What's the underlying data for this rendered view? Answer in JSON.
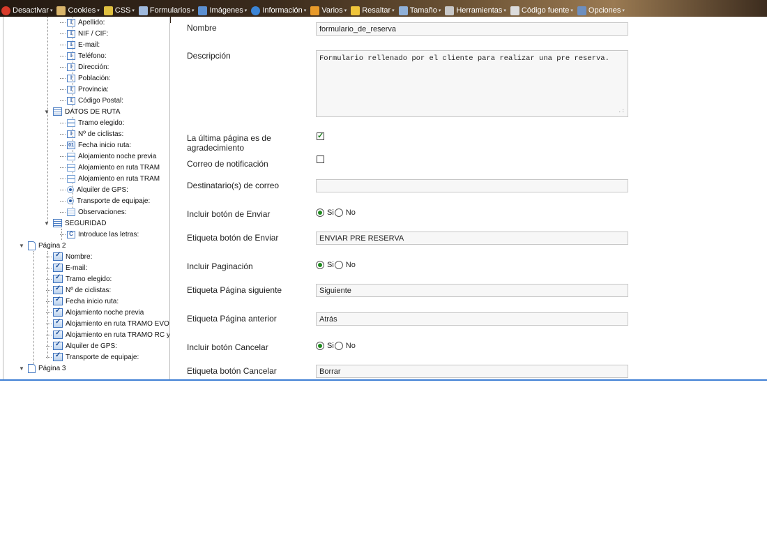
{
  "toolbar": {
    "items": [
      {
        "label": "Desactivar",
        "icon": "no-entry-icon",
        "color": "#d83a2a"
      },
      {
        "label": "Cookies",
        "icon": "person-icon",
        "color": "#d9b56b"
      },
      {
        "label": "CSS",
        "icon": "brush-icon",
        "color": "#e0c040"
      },
      {
        "label": "Formularios",
        "icon": "form-icon",
        "color": "#9fb9dd"
      },
      {
        "label": "Imágenes",
        "icon": "image-icon",
        "color": "#5b8fd1"
      },
      {
        "label": "Información",
        "icon": "info-icon",
        "color": "#3b84d6"
      },
      {
        "label": "Varios",
        "icon": "box-icon",
        "color": "#e89a2a"
      },
      {
        "label": "Resaltar",
        "icon": "pencil-icon",
        "color": "#f0c53a"
      },
      {
        "label": "Tamaño",
        "icon": "ruler-icon",
        "color": "#8fb0d8"
      },
      {
        "label": "Herramientas",
        "icon": "tools-icon",
        "color": "#c8c8c8"
      },
      {
        "label": "Código fuente",
        "icon": "document-icon",
        "color": "#dcdcdc"
      },
      {
        "label": "Opciones",
        "icon": "options-icon",
        "color": "#6d8fbf"
      }
    ]
  },
  "tree": {
    "rows": [
      {
        "label": "Apellido:",
        "icon": "text",
        "depth": 3
      },
      {
        "label": "NIF / CIF:",
        "icon": "text",
        "depth": 3
      },
      {
        "label": "E-mail:",
        "icon": "text",
        "depth": 3
      },
      {
        "label": "Teléfono:",
        "icon": "text",
        "depth": 3
      },
      {
        "label": "Dirección:",
        "icon": "text",
        "depth": 3
      },
      {
        "label": "Población:",
        "icon": "text",
        "depth": 3
      },
      {
        "label": "Provincia:",
        "icon": "text",
        "depth": 3
      },
      {
        "label": "Código Postal:",
        "icon": "text",
        "depth": 3
      },
      {
        "label": "DATOS DE RUTA",
        "icon": "group",
        "depth": 2,
        "expanded": true
      },
      {
        "label": "Tramo elegido:",
        "icon": "select",
        "depth": 3
      },
      {
        "label": "Nº de ciclistas:",
        "icon": "text",
        "depth": 3
      },
      {
        "label": "Fecha inicio ruta:",
        "icon": "date",
        "depth": 3
      },
      {
        "label": "Alojamiento noche previa",
        "icon": "select",
        "depth": 3
      },
      {
        "label": "Alojamiento en ruta TRAM",
        "icon": "select",
        "depth": 3
      },
      {
        "label": "Alojamiento en ruta TRAM",
        "icon": "select",
        "depth": 3
      },
      {
        "label": "Alquiler de GPS:",
        "icon": "radio",
        "depth": 3
      },
      {
        "label": "Transporte de equipaje:",
        "icon": "radio",
        "depth": 3
      },
      {
        "label": "Observaciones:",
        "icon": "area",
        "depth": 3
      },
      {
        "label": "SEGURIDAD",
        "icon": "group",
        "depth": 2,
        "expanded": true
      },
      {
        "label": "Introduce las letras:",
        "icon": "captcha",
        "depth": 3
      },
      {
        "label": "Página 2",
        "icon": "page",
        "depth": 1,
        "expanded": true
      },
      {
        "label": "Nombre:",
        "icon": "check",
        "depth": 2
      },
      {
        "label": "E-mail:",
        "icon": "check",
        "depth": 2
      },
      {
        "label": "Tramo elegido:",
        "icon": "check",
        "depth": 2
      },
      {
        "label": "Nº de ciclistas:",
        "icon": "check",
        "depth": 2
      },
      {
        "label": "Fecha inicio ruta:",
        "icon": "check",
        "depth": 2
      },
      {
        "label": "Alojamiento noche previa",
        "icon": "check",
        "depth": 2
      },
      {
        "label": "Alojamiento en ruta TRAMO EVO y",
        "icon": "check",
        "depth": 2
      },
      {
        "label": "Alojamiento en ruta TRAMO RC y",
        "icon": "check",
        "depth": 2
      },
      {
        "label": "Alquiler de GPS:",
        "icon": "check",
        "depth": 2
      },
      {
        "label": "Transporte de equipaje:",
        "icon": "check",
        "depth": 2
      },
      {
        "label": "Página 3",
        "icon": "page",
        "depth": 1,
        "expanded": true
      }
    ]
  },
  "form": {
    "nombre": {
      "label": "Nombre",
      "value": "formulario_de_reserva"
    },
    "descripcion": {
      "label": "Descripción",
      "value": "Formulario rellenado por el cliente para realizar una pre reserva."
    },
    "ultima_pagina": {
      "label": "La última página es de agradecimiento",
      "checked": true
    },
    "correo_notificacion": {
      "label": "Correo de notificación",
      "checked": false
    },
    "destinatario": {
      "label": "Destinatario(s) de correo",
      "value": ""
    },
    "incluir_enviar": {
      "label": "Incluir botón de Enviar",
      "si": "Si",
      "no": "No",
      "selected": "Si"
    },
    "etiqueta_enviar": {
      "label": "Etiqueta botón de Enviar",
      "value": "ENVIAR PRE RESERVA"
    },
    "incluir_paginacion": {
      "label": "Incluir Paginación",
      "si": "Si",
      "no": "No",
      "selected": "Si"
    },
    "etiqueta_siguiente": {
      "label": "Etiqueta Página siguiente",
      "value": "Siguiente"
    },
    "etiqueta_anterior": {
      "label": "Etiqueta Página anterior",
      "value": "Atrás"
    },
    "incluir_cancelar": {
      "label": "Incluir botón Cancelar",
      "si": "Si",
      "no": "No",
      "selected": "Si"
    },
    "etiqueta_cancelar": {
      "label": "Etiqueta botón Cancelar",
      "value": "Borrar"
    }
  },
  "colors": {
    "accent_line": "#3f7fd4",
    "radio_on": "#1f8a1f",
    "check_on": "#1a7a1a"
  }
}
